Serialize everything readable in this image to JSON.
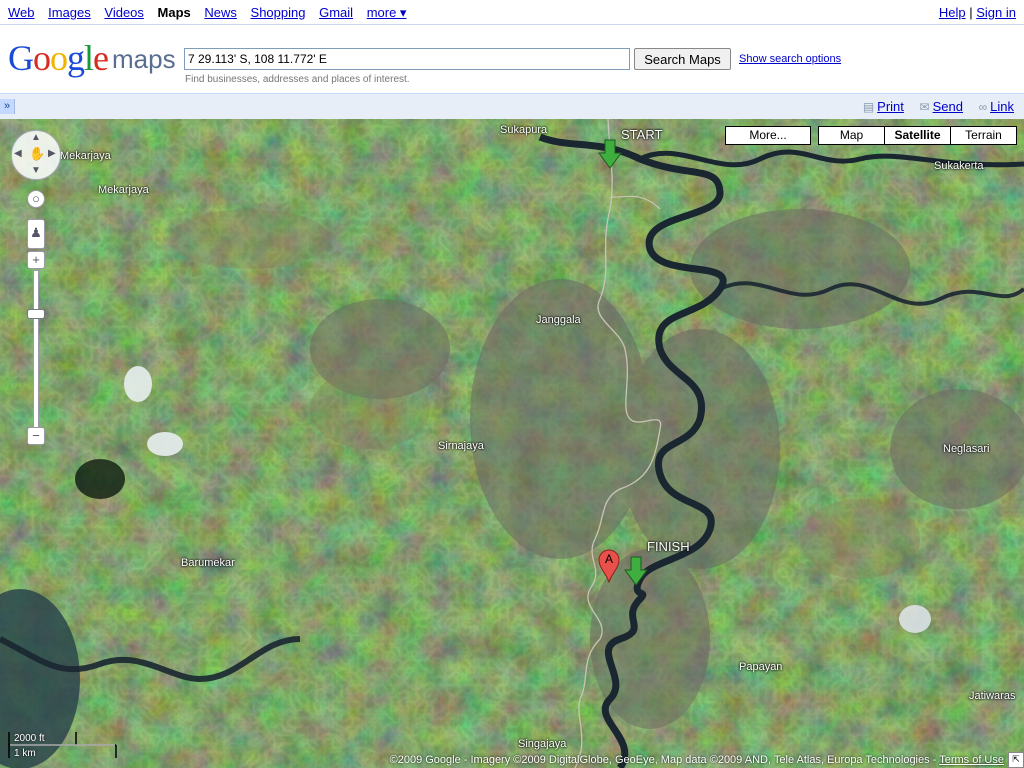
{
  "topnav": {
    "links": [
      "Web",
      "Images",
      "Videos",
      "Maps",
      "News",
      "Shopping",
      "Gmail",
      "more ▾"
    ],
    "current": "Maps",
    "help": "Help",
    "separator": "|",
    "signin": "Sign in"
  },
  "header": {
    "logo_google": "Google",
    "logo_maps": "maps",
    "search_value": "7 29.113' S, 108 11.772' E",
    "search_button": "Search Maps",
    "search_options": "Show search options",
    "hint": "Find businesses, addresses and places of interest."
  },
  "toolbar": {
    "collapse": "»",
    "print": "Print",
    "send": "Send",
    "link": "Link"
  },
  "map": {
    "type_buttons": [
      "More...",
      "Map",
      "Satellite",
      "Terrain"
    ],
    "selected_type": "Satellite",
    "places": [
      "Sukapura",
      "Mekarjaya",
      "Mekarjaya",
      "Sukakerta",
      "Janggala",
      "Sirnajaya",
      "Neglasari",
      "Barumekar",
      "Papayan",
      "Jatiwaras",
      "Singajaya"
    ],
    "start_label": "START",
    "finish_label": "FINISH",
    "marker_letter": "A",
    "scale_ft": "2000 ft",
    "scale_km": "1 km",
    "copyright": "©2009 Google - Imagery ©2009 DigitalGlobe, GeoEye, Map data ©2009 AND, Tele Atlas, Europa Technologies - ",
    "terms": "Terms of Use",
    "colors": {
      "marker_green": "#3fae3f",
      "marker_red": "#e8504a",
      "river": "#1a2630"
    }
  }
}
